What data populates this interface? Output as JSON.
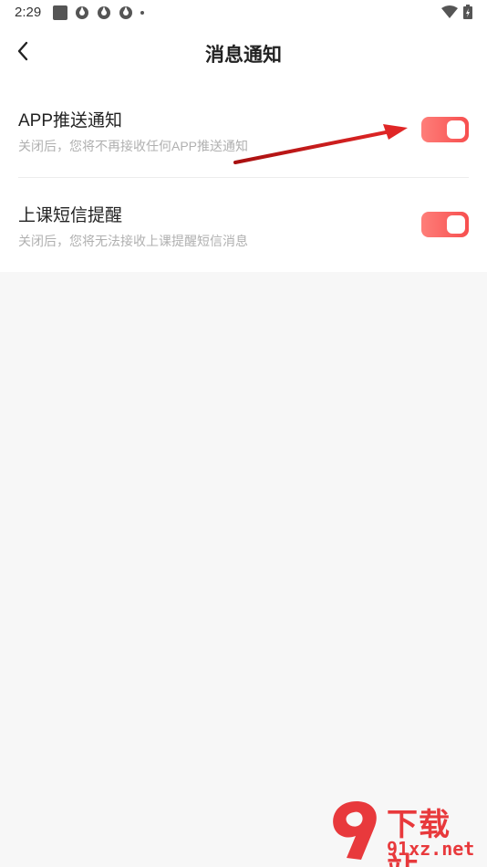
{
  "status_bar": {
    "time": "2:29"
  },
  "header": {
    "title": "消息通知"
  },
  "settings": [
    {
      "title": "APP推送通知",
      "description": "关闭后，您将不再接收任何APP推送通知",
      "enabled": true
    },
    {
      "title": "上课短信提醒",
      "description": "关闭后，您将无法接收上课提醒短信消息",
      "enabled": true
    }
  ],
  "colors": {
    "accent": "#fb5a58",
    "annotation_arrow": "#d81e1e"
  },
  "watermark": {
    "logo_text": "9",
    "name": "下载站",
    "domain": "91xz.net"
  }
}
